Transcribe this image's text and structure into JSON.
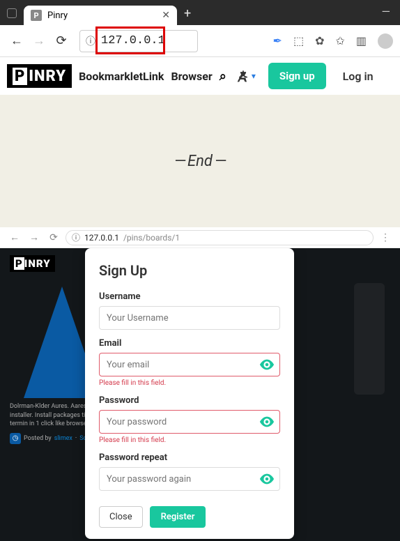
{
  "chrome": {
    "tab_title": "Pinry",
    "new_tab_plus": "+",
    "url": "127.0.0.1",
    "minimize": "—",
    "square": "▢"
  },
  "pinry": {
    "logo_p": "P",
    "logo_rest": "INRY",
    "link_bookmarklet": "BookmarkletLink",
    "link_browser": "Browser",
    "signup": "Sign up",
    "login": "Log in"
  },
  "end": {
    "text": "End"
  },
  "lower": {
    "url_host": "127.0.0.1",
    "url_path": "/pins/boards/1",
    "logo_p": "P",
    "logo_rest": "INRY",
    "bg_text": "Dolrman-Klder Aures. Aares is A … installer. Install packages tight fr… termin in 1 click like browser ex…",
    "posted_by": "Posted by",
    "posted_user": "slimex",
    "posted_sep": "·",
    "posted_src": "Sou…"
  },
  "modal": {
    "title": "Sign Up",
    "username_label": "Username",
    "username_placeholder": "Your Username",
    "email_label": "Email",
    "email_placeholder": "Your email",
    "email_error": "Please fill in this field.",
    "password_label": "Password",
    "password_placeholder": "Your password",
    "password_error": "Please fill in this field.",
    "repeat_label": "Password repeat",
    "repeat_placeholder": "Your password again",
    "close": "Close",
    "register": "Register"
  },
  "colors": {
    "accent": "#19c79e",
    "error": "#d43a4c"
  }
}
